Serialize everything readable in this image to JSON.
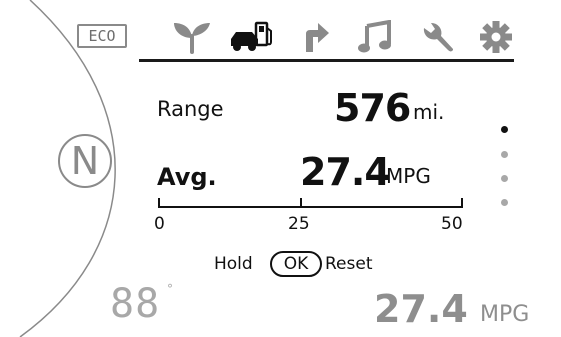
{
  "top_menu": {
    "mode_badge": "ECO",
    "icons": [
      {
        "name": "leaf-icon"
      },
      {
        "name": "car-fuel-icon",
        "selected": true
      },
      {
        "name": "turn-arrow-icon"
      },
      {
        "name": "music-note-icon"
      },
      {
        "name": "wrench-icon"
      },
      {
        "name": "gear-icon"
      }
    ]
  },
  "gear": {
    "position": "N"
  },
  "range": {
    "label": "Range",
    "value": "576",
    "unit": "mi."
  },
  "average": {
    "label": "Avg.",
    "value": "27.4",
    "unit": "MPG",
    "scale_ticks": [
      "0",
      "25",
      "50"
    ]
  },
  "reset_hint": {
    "hold": "Hold",
    "key": "OK",
    "action": "Reset"
  },
  "page_indicator": {
    "total": 4,
    "active": 1
  },
  "bottom": {
    "temperature": "88",
    "temperature_unit": "°",
    "mpg_value": "27.4",
    "mpg_unit": "MPG"
  },
  "colors": {
    "foreground": "#111111",
    "dimmed": "#8a8a8a",
    "faint": "#a8a8a8",
    "background": "#ffffff"
  }
}
